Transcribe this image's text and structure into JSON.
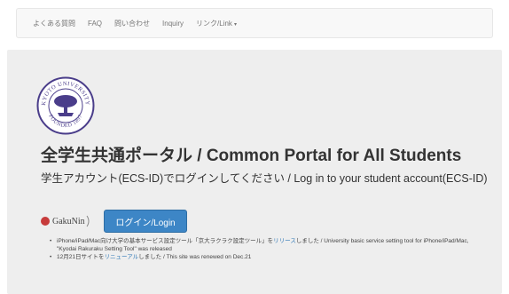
{
  "nav": {
    "items": [
      {
        "label": "よくある質問"
      },
      {
        "label": "FAQ"
      },
      {
        "label": "問い合わせ"
      },
      {
        "label": "Inquiry"
      },
      {
        "label": "リンク/Link",
        "caret": "▾"
      }
    ]
  },
  "seal": {
    "top_text": "KYOTO UNIVERSITY",
    "bottom_text": "FOUNDED 1897"
  },
  "main": {
    "title": "全学生共通ポータル / Common Portal for All Students",
    "subtitle": "学生アカウント(ECS-ID)でログインしてください / Log in to your student account(ECS-ID)",
    "gakunin_label": "GakuNin",
    "login_label": "ログイン/Login"
  },
  "news": {
    "item1": {
      "prefix": "iPhone/iPad/Mac向け大学の基本サービス設定ツール「京大ラクラク設定ツール」を",
      "link": "リリース",
      "suffix": "しました / University basic service setting tool for iPhone/iPad/Mac, \"Kyodai Rakuraku Setting Tool\" was released"
    },
    "item2": {
      "prefix": "12月21日サイトを",
      "link": "リニューアル",
      "suffix": "しました / This site was renewed on Dec.21"
    }
  },
  "colors": {
    "navbar_bg": "#f8f8f8",
    "jumbotron_bg": "#eeeeee",
    "primary_button": "#3d86c6",
    "link": "#337ab7",
    "seal_purple": "#4a3d8a",
    "gakunin_red": "#c73b3b"
  }
}
